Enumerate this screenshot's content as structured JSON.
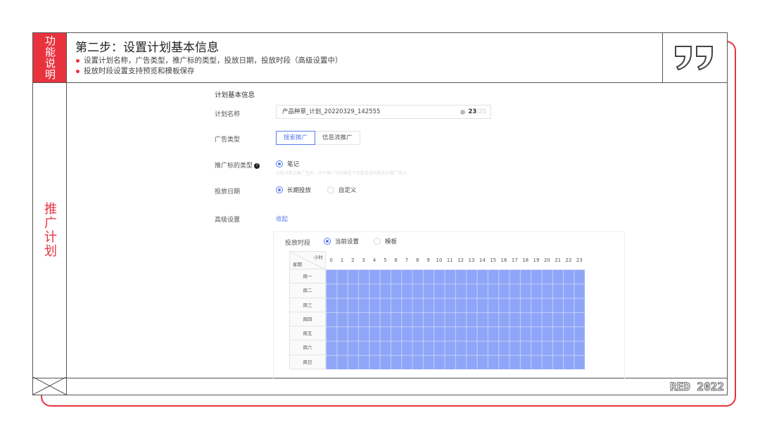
{
  "side": {
    "tag": "功能说明",
    "section": "推广计划"
  },
  "header": {
    "title": "第二步：设置计划基本信息",
    "bullets": [
      "设置计划名称，广告类型，推广标的类型，投放日期，投放时段（高级设置中）",
      "投放时段设置支持预览和模板保存"
    ]
  },
  "footer": {
    "badge": "RED 2022"
  },
  "form": {
    "section_title": "计划基本信息",
    "plan_name": {
      "label": "计划名称",
      "value": "产品种草_计划_20220329_142555",
      "count": "23",
      "max": "/25"
    },
    "ad_type": {
      "label": "广告类型",
      "options": [
        "搜索推广",
        "信息流推广"
      ],
      "selected": "搜索推广"
    },
    "target_type": {
      "label": "推广标的类型",
      "option": "笔记",
      "hint": "仅能对笔记推广生效，同个推广标的类型下仅能投放同类型的推广单元"
    },
    "date": {
      "label": "投放日期",
      "options": [
        "长期投放",
        "自定义"
      ],
      "selected": "长期投放"
    },
    "advanced": {
      "label": "高级设置",
      "link": "收起"
    },
    "timeslot": {
      "label": "投放时段",
      "options": [
        "当前设置",
        "模板"
      ],
      "selected": "当前设置"
    },
    "schedule": {
      "corner_hour": "小时",
      "corner_day": "星期",
      "hours": [
        "0",
        "1",
        "2",
        "3",
        "4",
        "5",
        "6",
        "7",
        "8",
        "9",
        "10",
        "11",
        "12",
        "13",
        "14",
        "15",
        "16",
        "17",
        "18",
        "19",
        "20",
        "21",
        "22",
        "23"
      ],
      "days": [
        "周一",
        "周二",
        "周三",
        "周四",
        "周五",
        "周六",
        "周日"
      ],
      "all_selected": true,
      "fill_color": "#8fa6f8"
    }
  },
  "colors": {
    "accent": "#e8333f",
    "primary": "#5a7cf0"
  }
}
